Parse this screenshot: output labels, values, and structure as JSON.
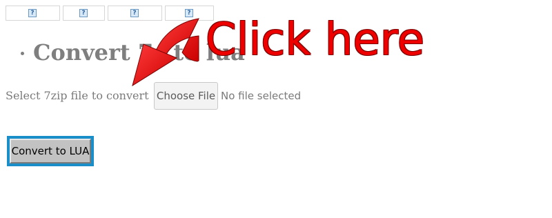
{
  "tabs": [
    {
      "icon": "broken-image-icon",
      "glyph": "?"
    },
    {
      "icon": "broken-image-icon",
      "glyph": "?"
    },
    {
      "icon": "broken-image-icon",
      "glyph": "?"
    },
    {
      "icon": "broken-image-icon",
      "glyph": "?"
    }
  ],
  "heading": "Convert 7z to lua",
  "file_input": {
    "label": "Select 7zip file to convert",
    "button_label": "Choose File",
    "status": "No file selected"
  },
  "convert_button": {
    "label": "Convert to LUA"
  },
  "annotation": {
    "text": "Click here",
    "color": "#ee0000",
    "arrow_icon": "curved-red-arrow-icon"
  },
  "colors": {
    "heading": "#7f7f7f",
    "focus_ring": "#1a8ec8",
    "button_face": "#c2c2c2"
  }
}
